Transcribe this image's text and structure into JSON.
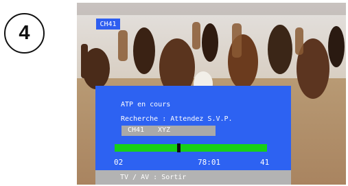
{
  "step": {
    "number": "4"
  },
  "channel_badge": {
    "label": "CH41"
  },
  "osd": {
    "title": "ATP en cours",
    "status": "Recherche : Attendez S.V.P.",
    "current_channel": "CH41",
    "current_name": "XYZ",
    "progress": {
      "fraction": 0.42
    },
    "start_value": "02",
    "center_value": "78:01",
    "end_value": "41",
    "footer": "TV / AV : Sortir"
  },
  "colors": {
    "panel": "#2d62f2",
    "progress_fill": "#17d017",
    "footer_bar": "#b3b3b3"
  }
}
